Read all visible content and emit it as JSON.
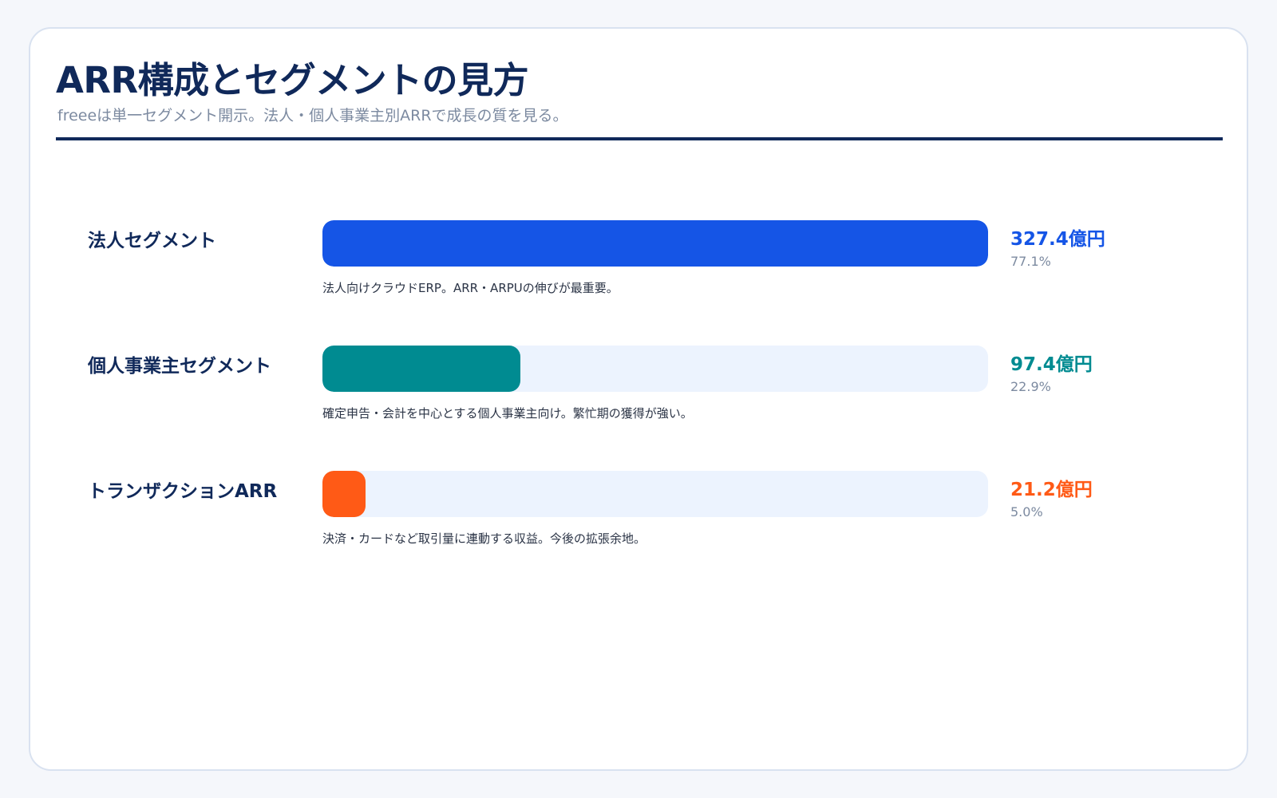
{
  "header": {
    "title": "ARR構成とセグメントの見方",
    "subtitle": "freeeは単一セグメント開示。法人・個人事業主別ARRで成長の質を見る。"
  },
  "chart_data": {
    "type": "bar",
    "orientation": "horizontal",
    "title": "ARR構成とセグメントの見方",
    "subtitle": "freeeは単一セグメント開示。法人・個人事業主別ARRで成長の質を見る。",
    "xlim": [
      0,
      327.4
    ],
    "categories": [
      "法人セグメント",
      "個人事業主セグメント",
      "トランザクションARR"
    ],
    "values": [
      327.4,
      97.4,
      21.2
    ],
    "series": [
      {
        "label": "法人セグメント",
        "value": 327.4,
        "value_label": "327.4億円",
        "share_label": "77.1%",
        "description": "法人向けクラウドERP。ARR・ARPUの伸びが最重要。",
        "color": "#1555e6"
      },
      {
        "label": "個人事業主セグメント",
        "value": 97.4,
        "value_label": "97.4億円",
        "share_label": "22.9%",
        "description": "確定申告・会計を中心とする個人事業主向け。繁忙期の獲得が強い。",
        "color": "#008b91"
      },
      {
        "label": "トランザクションARR",
        "value": 21.2,
        "value_label": "21.2億円",
        "share_label": "5.0%",
        "description": "決済・カードなど取引量に連動する収益。今後の拡張余地。",
        "color": "#ff5a16"
      }
    ]
  },
  "colors": {
    "title": "#10295a",
    "subtitle": "#7c8aa0",
    "track": "#ecf3fe",
    "card_border": "#d9e2f0"
  }
}
